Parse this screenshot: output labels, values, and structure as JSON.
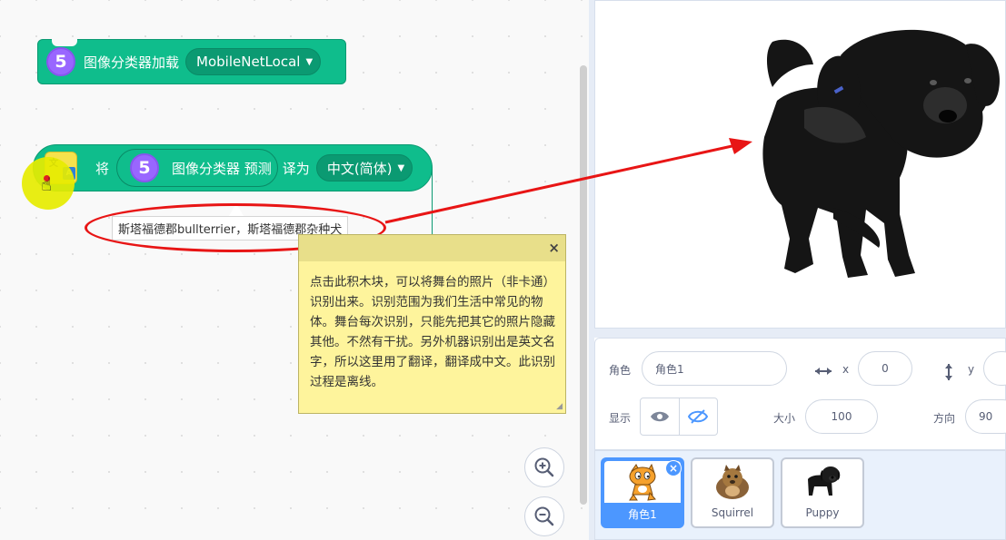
{
  "workspace": {
    "load_block": {
      "slot": "5",
      "text": "图像分类器加载",
      "model": "MobileNetLocal"
    },
    "translate_block": {
      "prefix": "将",
      "reporter_slot": "5",
      "reporter_text": "图像分类器 预测",
      "mid": "译为",
      "language": "中文(简体)"
    },
    "extension_icon": {
      "t1": "文",
      "t2": "A"
    },
    "tooltip": "斯塔福德郡bullterrier，斯塔福德郡杂种犬",
    "comment": "点击此积木块，可以将舞台的照片（非卡通）识别出来。识别范围为我们生活中常见的物体。舞台每次识别，只能先把其它的照片隐藏其他。不然有干扰。另外机器识别出是英文名字，所以这里用了翻译，翻译成中文。此识别过程是离线。",
    "comment_close": "×",
    "comment_resize": "◢"
  },
  "sprite_info": {
    "sprite_label": "角色",
    "sprite_name": "角色1",
    "x_label": "x",
    "x_value": "0",
    "y_label": "y",
    "y_value": "",
    "show_label": "显示",
    "size_label": "大小",
    "size_value": "100",
    "direction_label": "方向",
    "direction_value": "90"
  },
  "sprites": [
    {
      "name": "角色1",
      "selected": true
    },
    {
      "name": "Squirrel"
    },
    {
      "name": "Puppy"
    }
  ],
  "delete_badge": "×",
  "colors": {
    "motion_green": "#0fbd8c",
    "slot_purple": "#9966ff",
    "annotation_red": "#e81515",
    "selected_blue": "#4c97ff"
  }
}
